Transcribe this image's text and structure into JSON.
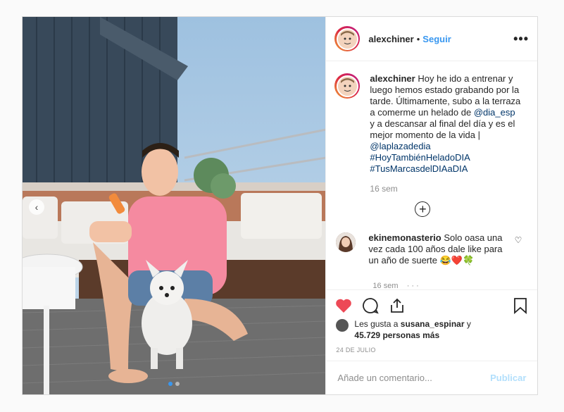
{
  "post": {
    "username": "alexchiner",
    "separator": "•",
    "follow_label": "Seguir",
    "more_label": "•••",
    "caption": {
      "username": "alexchiner",
      "text_1": "Hoy he ido a entrenar y luego hemos estado grabando por la tarde. Últimamente, subo a la terraza a comerme un helado de",
      "mention_1": "@dia_esp",
      "text_2": "y a descansar al final del día y es el mejor momento de la vida |",
      "mention_2": "@laplazadedia",
      "hashtag_1": "#HoyTambiénHeladoDIA",
      "hashtag_2": "#TusMarcasdelDIAaDIA",
      "time": "16 sem"
    },
    "load_more_label": "+",
    "comment": {
      "username": "ekinemonasterio",
      "text": "Solo oasa una vez cada 100 años dale like para un año de suerte 😂❤️🍀"
    },
    "likes": {
      "prefix": "Les gusta a",
      "user": "susana_espinar",
      "conj": "y",
      "count": "45.729 personas más"
    },
    "date": "24 DE JULIO",
    "add_comment_placeholder": "Añade un comentario...",
    "publish_label": "Publicar",
    "carousel": {
      "current": 1,
      "total": 2
    }
  },
  "colors": {
    "accent": "#3897f0",
    "like_red": "#ed4956",
    "link": "#003569",
    "muted": "#8e8e8e"
  },
  "icons": [
    "heart-icon",
    "comment-icon",
    "share-icon",
    "bookmark-icon",
    "more-icon",
    "add-circle-icon",
    "chevron-left-icon"
  ]
}
